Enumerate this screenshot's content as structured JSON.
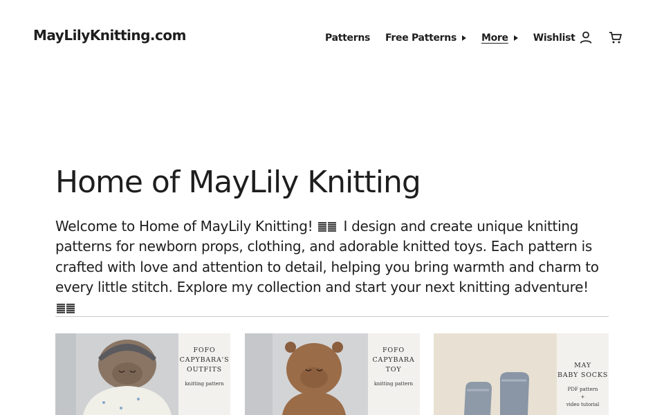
{
  "header": {
    "site_title": "MayLilyKnitting.com",
    "nav": [
      {
        "label": "Patterns",
        "has_caret": false
      },
      {
        "label": "Free Patterns",
        "has_caret": true
      },
      {
        "label": "More",
        "has_caret": true
      },
      {
        "label": "Wishlist",
        "has_caret": false
      }
    ],
    "icons": [
      "account-icon",
      "cart-icon"
    ]
  },
  "main": {
    "title": "Home of MayLily Knitting",
    "intro_prefix": "Welcome to ",
    "intro_strong": "Home of MayLily Knitting",
    "intro_after_strong": "!",
    "intro_body": " I design and create unique knitting patterns for newborn props, clothing, and adorable knitted toys. Each pattern is crafted with love and attention to detail, helping you bring warmth and charm to every little stitch. Explore my collection and start your next knitting adventure!"
  },
  "cards": [
    {
      "title": "FOFO\nCAPYBARA'S\nOUTFITS",
      "subtitle": "knitting pattern"
    },
    {
      "title": "FOFO\nCAPYBARA\nTOY",
      "subtitle": "knitting pattern"
    },
    {
      "title": "MAY\nBABY SOCKS",
      "subtitle": "PDF pattern\n+\nvideo tutorial"
    }
  ],
  "colors": {
    "text": "#1e1e1e",
    "background": "#ffffff",
    "divider": "#c9c9c9",
    "label_panel": "#f3f1ee"
  }
}
